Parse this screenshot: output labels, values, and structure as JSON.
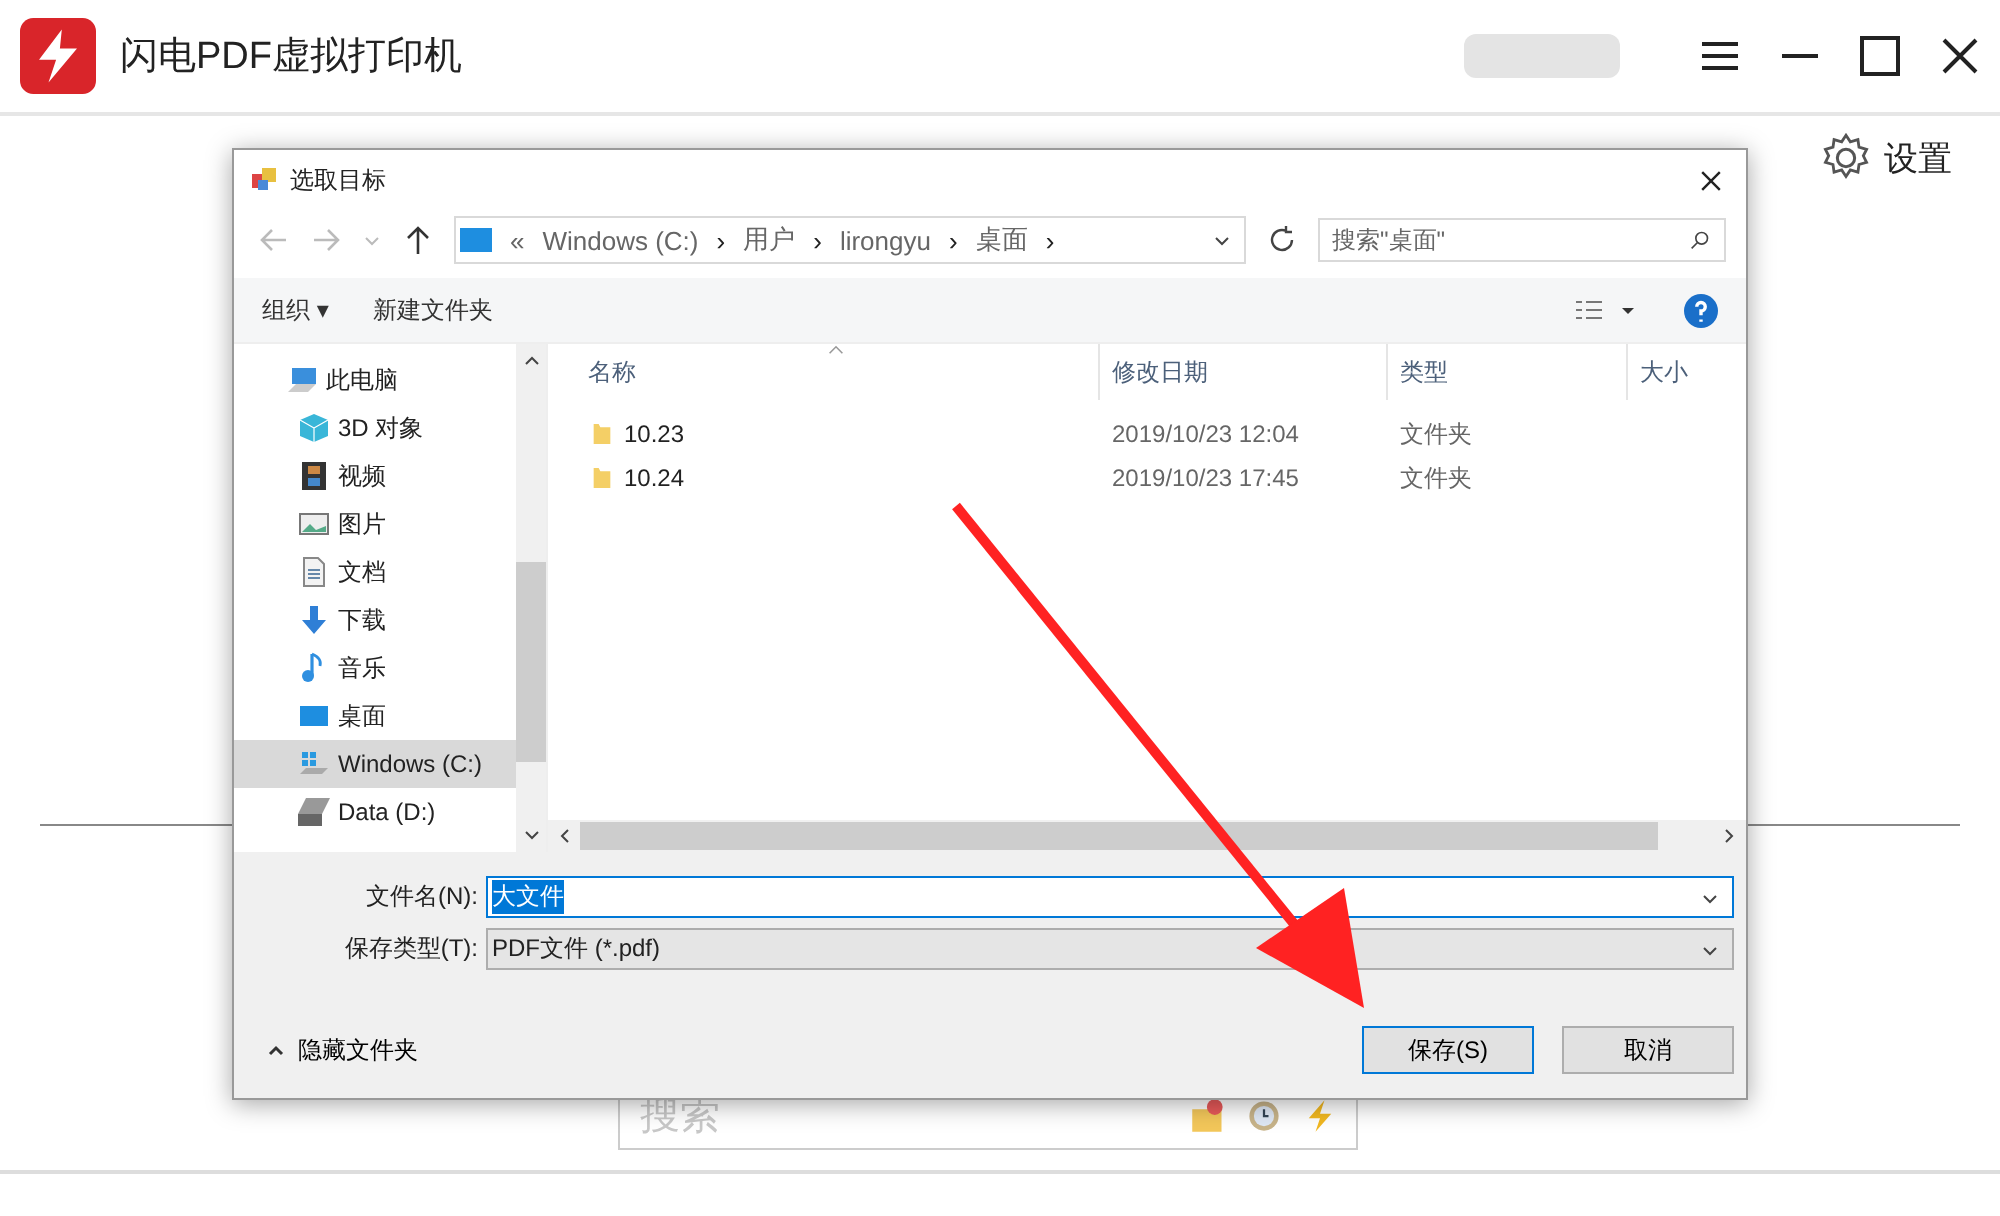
{
  "app": {
    "title": "闪电PDF虚拟打印机",
    "settings": "设置",
    "search": {
      "placeholder": "搜索"
    }
  },
  "dialog": {
    "title": "选取目标",
    "address": [
      "«",
      "Windows (C:)",
      "›",
      "用户",
      "›",
      "lirongyu",
      "›",
      "桌面",
      "›"
    ],
    "search_placeholder": "搜索\"桌面\"",
    "toolbar": {
      "organize": "组织 ▾",
      "new_folder": "新建文件夹"
    },
    "nav": [
      {
        "label": "此电脑",
        "selected": false
      },
      {
        "label": "3D 对象",
        "selected": false
      },
      {
        "label": "视频",
        "selected": false
      },
      {
        "label": "图片",
        "selected": false
      },
      {
        "label": "文档",
        "selected": false
      },
      {
        "label": "下载",
        "selected": false
      },
      {
        "label": "音乐",
        "selected": false
      },
      {
        "label": "桌面",
        "selected": false
      },
      {
        "label": "Windows (C:)",
        "selected": true
      },
      {
        "label": "Data (D:)",
        "selected": false
      }
    ],
    "columns": [
      "名称",
      "修改日期",
      "类型",
      "大小"
    ],
    "rows": [
      {
        "name": "10.23",
        "modified": "2019/10/23 12:04",
        "type": "文件夹"
      },
      {
        "name": "10.24",
        "modified": "2019/10/23 17:45",
        "type": "文件夹"
      }
    ],
    "filename_label": "文件名(N):",
    "filename": "大文件",
    "filetype_label": "保存类型(T):",
    "filetype": "PDF文件 (*.pdf)",
    "hide_folders": "隐藏文件夹",
    "save": "保存(S)",
    "cancel": "取消"
  }
}
